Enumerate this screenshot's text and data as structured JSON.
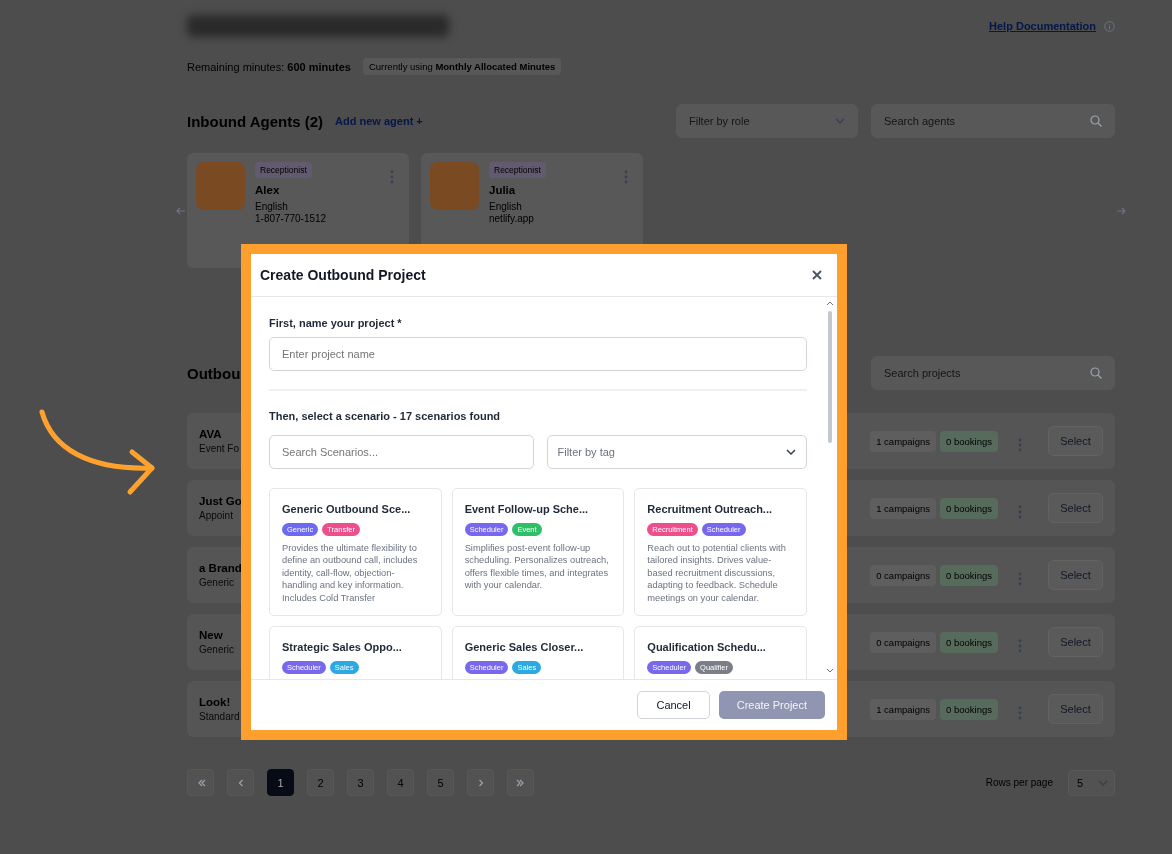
{
  "page": {
    "help_link": "Help Documentation",
    "remaining_label": "Remaining minutes:",
    "remaining_value": "600 minutes",
    "usage_prefix": "Currently using",
    "usage_value": "Monthly Allocated Minutes"
  },
  "inbound": {
    "title": "Inbound Agents (2)",
    "add_link": "Add new agent +",
    "filter": {
      "placeholder": "Filter by role"
    },
    "search": {
      "placeholder": "Search agents"
    },
    "agents": [
      {
        "role": "Receptionist",
        "name": "Alex",
        "language": "English",
        "contact": "1-807-770-1512"
      },
      {
        "role": "Receptionist",
        "name": "Julia",
        "language": "English",
        "contact": "netlify.app"
      }
    ]
  },
  "outbound": {
    "title": "Outbou",
    "search": {
      "placeholder": "Search projects"
    },
    "projects": [
      {
        "name": "AVA",
        "subtitle": "Event Fo",
        "campaigns": "1 campaigns",
        "bookings": "0 bookings",
        "action": "Select"
      },
      {
        "name": "Just Go",
        "subtitle": "Appoint",
        "campaigns": "1 campaigns",
        "bookings": "0 bookings",
        "action": "Select"
      },
      {
        "name": "a Brand",
        "subtitle": "Generic",
        "campaigns": "0 campaigns",
        "bookings": "0 bookings",
        "action": "Select"
      },
      {
        "name": "New",
        "subtitle": "Generic",
        "campaigns": "0 campaigns",
        "bookings": "0 bookings",
        "action": "Select"
      },
      {
        "name": "Look!",
        "subtitle": "Standard",
        "campaigns": "1 campaigns",
        "bookings": "0 bookings",
        "action": "Select"
      }
    ]
  },
  "pagination": {
    "pages": [
      {
        "label": "1",
        "selected": true
      },
      {
        "label": "2",
        "selected": false
      },
      {
        "label": "3",
        "selected": false
      },
      {
        "label": "4",
        "selected": false
      },
      {
        "label": "5",
        "selected": false
      }
    ],
    "rows_label": "Rows per page",
    "rows_value": "5"
  },
  "modal": {
    "title": "Create Outbound Project",
    "name_label": "First, name your project *",
    "name_field": {
      "placeholder": "Enter project name"
    },
    "scenario_label": "Then, select a scenario - 17 scenarios found",
    "scenario_search": {
      "placeholder": "Search Scenarios..."
    },
    "tag_filter": {
      "placeholder": "Filter by tag"
    },
    "scenarios": [
      {
        "title": "Generic Outbound Sce...",
        "tags": [
          {
            "label": "Generic",
            "color": "#6d6af0"
          },
          {
            "label": "Transfer",
            "color": "#ec4f8c"
          }
        ],
        "description": "Provides the ultimate flexibility to define an outbound call, includes identity, call-flow, objection-handling and key information. Includes Cold Transfer"
      },
      {
        "title": "Event Follow-up Sche...",
        "tags": [
          {
            "label": "Scheduler",
            "color": "#7768ee"
          },
          {
            "label": "Event",
            "color": "#2fbf66"
          }
        ],
        "description": "Simplifies post-event follow-up scheduling. Personalizes outreach, offers flexible times, and integrates with your calendar."
      },
      {
        "title": "Recruitment Outreach...",
        "tags": [
          {
            "label": "Recruitment",
            "color": "#ec4f8c"
          },
          {
            "label": "Scheduler",
            "color": "#7768ee"
          }
        ],
        "description": "Reach out to potential clients with tailored insights. Drives value-based recruitment discussions, adapting to feedback. Schedule meetings on your calendar."
      },
      {
        "title": "Strategic Sales Oppo...",
        "tags": [
          {
            "label": "Scheduler",
            "color": "#7768ee"
          },
          {
            "label": "Sales",
            "color": "#2aa9e2"
          }
        ]
      },
      {
        "title": "Generic Sales Closer...",
        "tags": [
          {
            "label": "Scheduler",
            "color": "#7768ee"
          },
          {
            "label": "Sales",
            "color": "#2aa9e2"
          }
        ]
      },
      {
        "title": "Qualification Schedu...",
        "tags": [
          {
            "label": "Scheduler",
            "color": "#7768ee"
          },
          {
            "label": "Qualifier",
            "color": "#7a7f87"
          }
        ]
      }
    ],
    "buttons": [
      {
        "label": "Cancel",
        "kind": "secondary",
        "disabled": false
      },
      {
        "label": "Create Project",
        "kind": "primary",
        "disabled": true
      }
    ]
  }
}
